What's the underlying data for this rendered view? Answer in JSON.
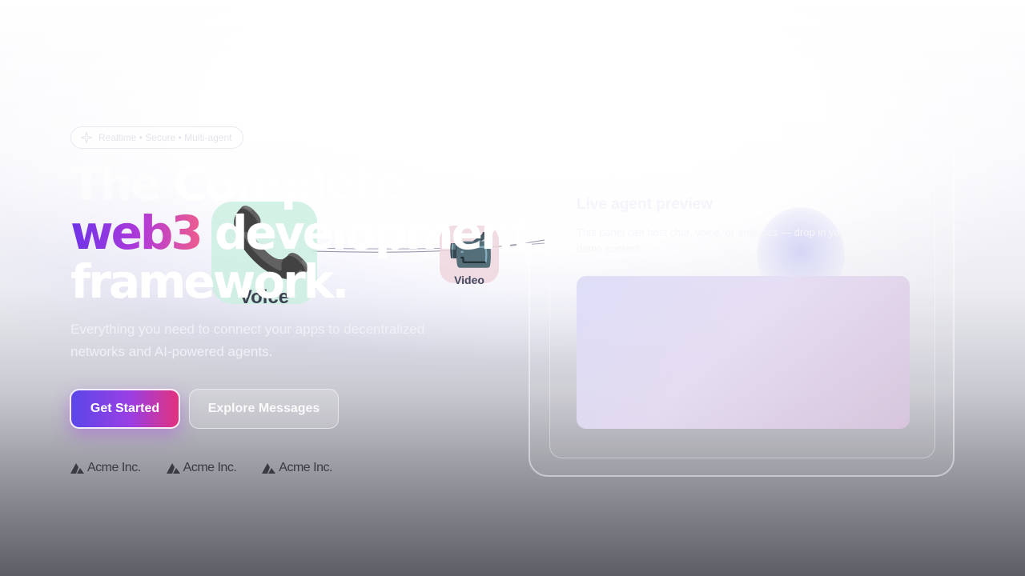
{
  "hero": {
    "pill_text": "Realtime • Secure • Multi-agent",
    "heading_line1_pre": "The",
    "heading_line1_post": "Complete",
    "heading_highlight": "web3",
    "heading_line2_post": "development",
    "heading_line3": "framework.",
    "subtitle": "Everything you need to connect your apps to decentralized networks and AI-powered agents.",
    "primary_button": "Get Started",
    "secondary_button": "Explore Messages"
  },
  "channels": {
    "voice_label": "Voice",
    "voice_emoji": "📞",
    "video_label": "Video",
    "video_emoji": "📹"
  },
  "logos": [
    "Acme Inc.",
    "Acme Inc.",
    "Acme Inc."
  ],
  "preview": {
    "title": "Live agent preview",
    "description": "This panel can host chat, voice, or analytics — drop in your demo content."
  },
  "colors": {
    "gradient_start": "#5b46e8",
    "gradient_mid": "#9a3fe4",
    "gradient_end": "#e2317d"
  }
}
